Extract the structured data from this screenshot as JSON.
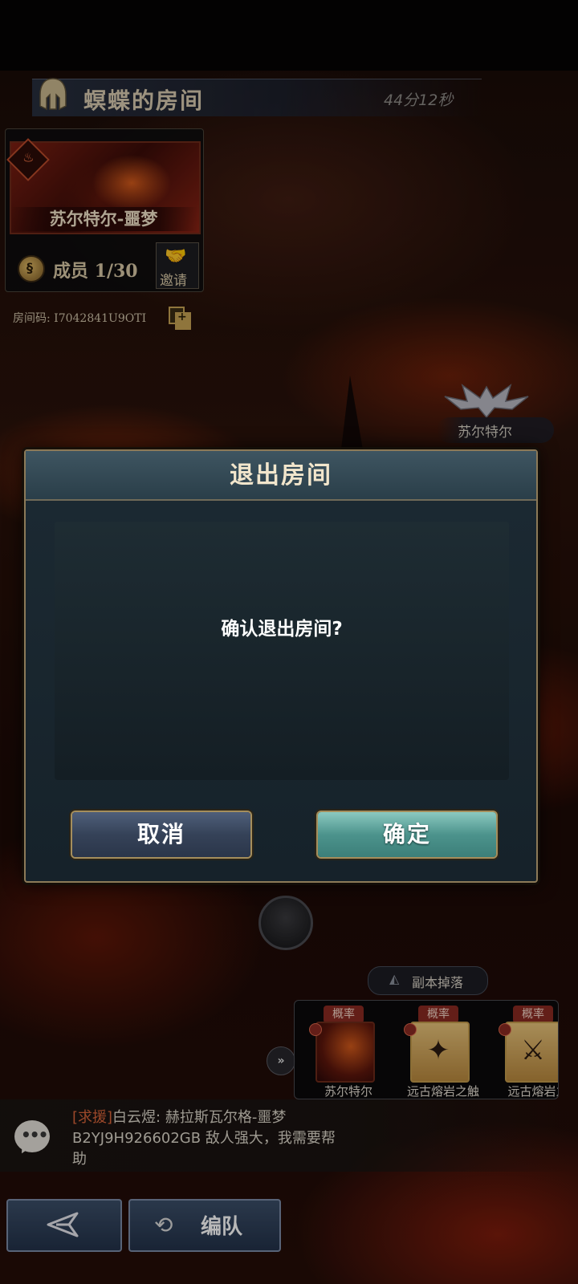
{
  "header": {
    "room_title": "螟蝶的房间",
    "timer": "44分12秒"
  },
  "boss_card": {
    "boss_name": "苏尔特尔-噩梦",
    "members": "成员 1/30",
    "invite_label": "邀请"
  },
  "room_code": "房间码: I7042841U9OTI",
  "boss_marker": {
    "label": "苏尔特尔"
  },
  "dialog": {
    "title": "退出房间",
    "message": "确认退出房间?",
    "cancel_label": "取消",
    "confirm_label": "确定"
  },
  "drops": {
    "tab_label": "副本掉落",
    "items": [
      {
        "rate_label": "概率",
        "name": "苏尔特尔"
      },
      {
        "rate_label": "概率",
        "name": "远古熔岩之触"
      },
      {
        "rate_label": "概率",
        "name": "远古熔岩之"
      }
    ]
  },
  "chat": {
    "tag": "[求援]",
    "line1": "白云煜: 赫拉斯瓦尔格-噩梦",
    "line2": "B2YJ9H926602GB 敌人强大，我需要帮",
    "line3": "助"
  },
  "bottom_bar": {
    "team_label": "编队"
  },
  "colors": {
    "accent_gold": "#a58e5c",
    "confirm_teal": "#4c938c",
    "cancel_blue": "#354258",
    "help_tag": "#d8643a"
  }
}
